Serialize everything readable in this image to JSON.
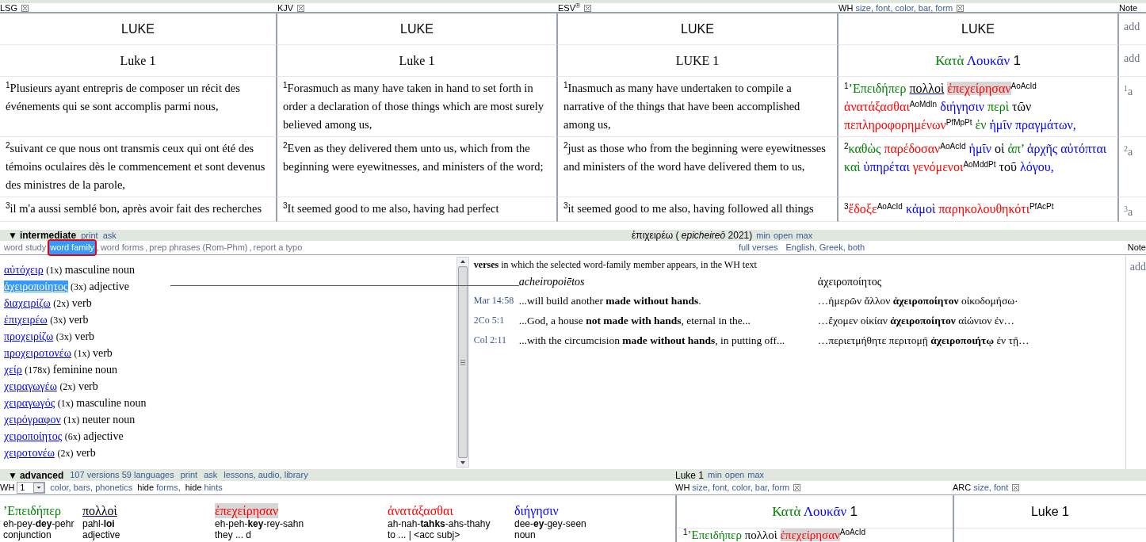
{
  "top_panel": {
    "columns": [
      {
        "kind": "plain",
        "label": "LSG",
        "book": "LUKE",
        "chapter": "Luke 1",
        "verses": [
          {
            "number": "1",
            "text": "Plusieurs ayant entrepris de composer un récit des événements qui se sont accomplis parmi nous,"
          },
          {
            "number": "2",
            "text": "suivant ce que nous ont transmis ceux qui ont été des témoins oculaires dès le commencement et sont devenus des ministres de la parole,"
          },
          {
            "number": "3",
            "text": "il m'a aussi semblé bon, après avoir fait des recherches"
          }
        ]
      },
      {
        "kind": "plain",
        "label": "KJV",
        "book": "LUKE",
        "chapter": "Luke 1",
        "verses": [
          {
            "number": "1",
            "text": "Forasmuch as many have taken in hand to set forth in order a declaration of those things which are most surely believed among us,"
          },
          {
            "number": "2",
            "text": "Even as they delivered them unto us, which from the beginning were eyewitnesses, and ministers of the word;"
          },
          {
            "number": "3",
            "text": "It seemed good to me also, having had perfect"
          }
        ]
      },
      {
        "kind": "plain",
        "label": "ESV$^{®}$",
        "book": "LUKE",
        "chapter": "LUKE 1",
        "verses": [
          {
            "number": "1",
            "text": "Inasmuch as many have undertaken to compile a narrative of the things that have been accomplished among us,"
          },
          {
            "number": "2",
            "text": "just as those who from the beginning were eyewitnesses and ministers of the word have delivered them to us,"
          },
          {
            "number": "3",
            "text": "it seemed good to me also, having followed all things"
          }
        ]
      },
      {
        "kind": "greek",
        "label": "WH",
        "options": "size, font, color, bar, form",
        "book": "LUKE",
        "chapter_words": [
          {
            "text": "Κατὰ",
            "color": "#008000"
          },
          {
            "text": "Λουκᾶν",
            "color": "#0000ff"
          },
          {
            "text": "1",
            "color": "#000000"
          }
        ],
        "verses": [
          {
            "number": "1",
            "words": [
              {
                "text": "’Επειδήπερ",
                "color": "#008000",
                "kind": "plain"
              },
              {
                "text": "πολλοὶ",
                "color": "#000000",
                "kind": "link"
              },
              {
                "text": "ἐπεχείρησαν",
                "color": "#ff0000",
                "kind": "selected",
                "parse": "AoAcId"
              },
              {
                "text": "ἀνατάξασθαι",
                "color": "#ff0000",
                "kind": "plain",
                "parse": "AoMdIn"
              },
              {
                "text": "διήγησιν",
                "color": "#0000ff",
                "kind": "plain"
              },
              {
                "text": "περὶ",
                "color": "#008000",
                "kind": "plain"
              },
              {
                "text": "τῶν",
                "color": "#000000",
                "kind": "plain"
              },
              {
                "text": "πεπληροφορημένων",
                "color": "#ff0000",
                "kind": "plain",
                "parse": "PfMpPt"
              },
              {
                "text": "ἐν",
                "color": "#008000",
                "kind": "plain"
              },
              {
                "text": "ἡμῖν",
                "color": "#0000ff",
                "kind": "plain"
              },
              {
                "text": "πραγμάτων,",
                "color": "#0000ff",
                "kind": "plain"
              }
            ]
          },
          {
            "number": "2",
            "words": [
              {
                "text": "καθὼς",
                "color": "#008000",
                "kind": "plain"
              },
              {
                "text": "παρέδοσαν",
                "color": "#ff0000",
                "kind": "plain",
                "parse": "AoAcId"
              },
              {
                "text": "ἡμῖν",
                "color": "#0000ff",
                "kind": "plain"
              },
              {
                "text": "οἱ",
                "color": "#000000",
                "kind": "plain"
              },
              {
                "text": "ἀπ’",
                "color": "#008000",
                "kind": "plain"
              },
              {
                "text": "ἀρχῆς",
                "color": "#0000ff",
                "kind": "plain"
              },
              {
                "text": "αὐτόπται",
                "color": "#0000ff",
                "kind": "plain"
              },
              {
                "text": "καὶ",
                "color": "#008000",
                "kind": "plain"
              },
              {
                "text": "ὑπηρέται",
                "color": "#0000ff",
                "kind": "plain"
              },
              {
                "text": "γενόμενοι",
                "color": "#ff0000",
                "kind": "plain",
                "parse": "AoMddPt"
              },
              {
                "text": "τοῦ",
                "color": "#000000",
                "kind": "plain"
              },
              {
                "text": "λόγου,",
                "color": "#0000ff",
                "kind": "plain"
              }
            ]
          },
          {
            "number": "3",
            "words": [
              {
                "text": "ἔδοξε",
                "color": "#ff0000",
                "kind": "plain",
                "parse": "AoAcId"
              },
              {
                "text": "κἀμοὶ",
                "color": "#0000ff",
                "kind": "plain"
              },
              {
                "text": "παρηκολουθηκότι",
                "color": "#ff0000",
                "kind": "plain",
                "parse": "PfAcPt"
              }
            ]
          }
        ]
      }
    ],
    "notes": {
      "label": "Note",
      "entries": [
        {
          "text": "add"
        },
        {
          "text": "add"
        },
        {
          "number": "1",
          "text": "a"
        },
        {
          "number": "2",
          "text": "a"
        },
        {
          "number": "3",
          "text": "a"
        }
      ]
    }
  },
  "intermediate": {
    "toggle": "▼",
    "title": "intermediate",
    "actions": [
      "print",
      "ask"
    ],
    "word": "ἐπιχειρέω ( *epicheireō* 2021)",
    "size_controls": [
      "min",
      "open",
      "max"
    ],
    "tabs": [
      {
        "label": "word study",
        "selected": false
      },
      {
        "label": "word family",
        "suffix": ",",
        "selected": true
      },
      {
        "label": "word forms",
        "suffix": ",",
        "selected": false
      },
      {
        "label": "prep phrases (Rom-Phm)",
        "suffix": ",",
        "selected": false
      },
      {
        "label": "report a typo",
        "selected": false
      }
    ],
    "verse_options": [
      "full verses",
      "English, Greek, both"
    ],
    "notes_label": "Note",
    "family": [
      {
        "word": "αὐτόχειρ",
        "count": "(1x)",
        "pos": "masculine noun",
        "selected": false
      },
      {
        "word": "ἀχειροποίητος",
        "count": "(3x)",
        "pos": "adjective",
        "selected": true
      },
      {
        "word": "διαχειρίζω",
        "count": "(2x)",
        "pos": "verb",
        "selected": false
      },
      {
        "word": "ἐπιχειρέω",
        "count": "(3x)",
        "pos": "verb",
        "selected": false
      },
      {
        "word": "προχειρίζω",
        "count": "(3x)",
        "pos": "verb",
        "selected": false
      },
      {
        "word": "προχειροτονέω",
        "count": "(1x)",
        "pos": "verb",
        "selected": false
      },
      {
        "word": "χείρ",
        "count": "(178x)",
        "pos": "feminine noun",
        "selected": false
      },
      {
        "word": "χειραγωγέω",
        "count": "(2x)",
        "pos": "verb",
        "selected": false
      },
      {
        "word": "χειραγωγός",
        "count": "(1x)",
        "pos": "masculine noun",
        "selected": false
      },
      {
        "word": "χειρόγραφον",
        "count": "(1x)",
        "pos": "neuter noun",
        "selected": false
      },
      {
        "word": "χειροποίητος",
        "count": "(6x)",
        "pos": "adjective",
        "selected": false
      },
      {
        "word": "χειροτονέω",
        "count": "(2x)",
        "pos": "verb",
        "selected": false
      }
    ],
    "verses_heading": "**verses** in which the selected word-family member appears, in the WH text",
    "transliteration": "acheiropoiētos",
    "lemma": "ἀχειροποίητος",
    "occurrences": [
      {
        "ref": "Mar 14:58",
        "english": "...will build another **made without hands**.",
        "greek": "…ἡμερῶν ἄλλον **ἀχειροποίητον** οἰκοδομήσω·"
      },
      {
        "ref": "2Co 5:1",
        "english": "...God, a house **not made with hands**, eternal in the...",
        "greek": "…ἔχομεν οἰκίαν **ἀχειροποίητον** αἰώνιον ἐν…"
      },
      {
        "ref": "Col 2:11",
        "english": "...with the circumcision **made without hands**, in putting off...",
        "greek": "…περιετμήθητε περιτομῇ **ἀχειροποιήτῳ** ἐν τῇ…"
      }
    ],
    "note_entry": "add"
  },
  "advanced": {
    "toggle": "▼",
    "title": "advanced",
    "links": [
      "107 versions 59 languages",
      "print",
      "ask",
      "lessons, audio, library"
    ],
    "location": "Luke 1",
    "size_controls": [
      "min",
      "open",
      "max"
    ],
    "version": "WH",
    "select_value": "1",
    "display_links": "color, bars, phonetics",
    "hide_toggles": [
      {
        "action": "hide",
        "target": "forms,"
      },
      {
        "action": "hide",
        "target": "hints"
      }
    ],
    "interlinear": [
      {
        "greek": "’Επειδήπερ",
        "color": "#008000",
        "kind": "plain",
        "phonetic": "eh-pey-**dey**-pehr",
        "pos": "conjunction"
      },
      {
        "greek": "πολλοὶ",
        "color": "#000000",
        "kind": "link",
        "phonetic": "pahl-**loi**",
        "pos": "adjective"
      },
      {
        "greek": "ἐπεχείρησαν",
        "color": "#ff0000",
        "kind": "selected",
        "phonetic": "eh-peh-**key**-rey-sahn",
        "pos": "they ... d"
      },
      {
        "greek": "ἀνατάξασθαι",
        "color": "#ff0000",
        "kind": "plain",
        "phonetic": "ah-nah-**tahks**-ahs-thahy",
        "pos": "to ... | <acc subj>"
      },
      {
        "greek": "διήγησιν",
        "color": "#0000ff",
        "kind": "plain",
        "phonetic": "dee-**ey**-gey-seen",
        "pos": "noun"
      }
    ],
    "parallel_columns": [
      {
        "kind": "greek",
        "label": "WH",
        "options": "size, font, color, bar, form",
        "chapter_words": [
          {
            "text": "Κατὰ",
            "color": "#008000"
          },
          {
            "text": "Λουκᾶν",
            "color": "#0000ff"
          },
          {
            "text": "1",
            "color": "#000000"
          }
        ],
        "verse": {
          "number": "1",
          "words": [
            {
              "text": "’Επειδήπερ",
              "color": "#008000",
              "kind": "plain"
            },
            {
              "text": "πολλοὶ",
              "color": "#000000",
              "kind": "plain"
            },
            {
              "text": "ἐπεχείρησαν",
              "color": "#ff0000",
              "kind": "selected",
              "parse": "AoAcId"
            }
          ]
        }
      },
      {
        "kind": "plain",
        "label": "ARC",
        "options": "size, font",
        "chapter": "Luke 1"
      }
    ]
  }
}
